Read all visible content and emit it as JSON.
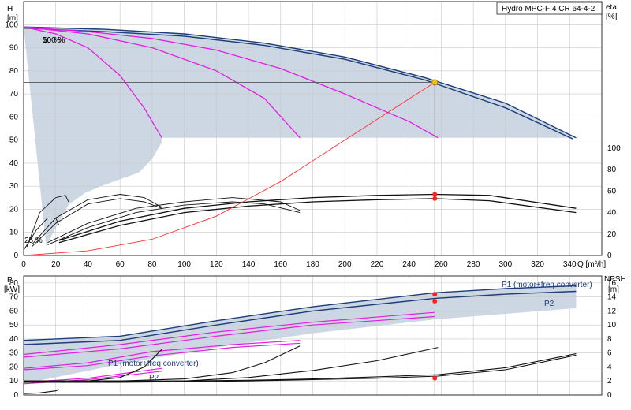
{
  "title": "Hydro MPC-F 4 CR 64-4-2",
  "chart_data": [
    {
      "type": "line",
      "name": "head_efficiency",
      "title": "Hydro MPC-F 4 CR 64-4-2",
      "xlabel": "Q [m³/h]",
      "ylabel_left_lines": [
        "H",
        "[m]"
      ],
      "ylabel_right_lines": [
        "eta",
        "[%]"
      ],
      "xlim": [
        0,
        360
      ],
      "ylim_left": [
        0,
        110
      ],
      "ylim_right_eta": [
        0,
        100
      ],
      "x_ticks": [
        0,
        20,
        40,
        60,
        80,
        100,
        120,
        140,
        160,
        180,
        200,
        220,
        240,
        260,
        280,
        300,
        320,
        340
      ],
      "y_ticks_left": [
        0,
        10,
        20,
        30,
        40,
        50,
        60,
        70,
        80,
        90,
        100
      ],
      "y_ticks_right": [
        0,
        20,
        40,
        60,
        80,
        100
      ],
      "grid": true,
      "speed_labels": [
        {
          "text": "100 %",
          "q": 23,
          "h": 100
        },
        {
          "text": "50 %",
          "q": 23,
          "h": 100
        },
        {
          "text": "25 %",
          "q": 0,
          "h": 7
        }
      ],
      "duty_point": {
        "q": 256,
        "h": 75
      },
      "head_curves_blue": [
        {
          "q": [
            0,
            50,
            100,
            150,
            200,
            250,
            300,
            344
          ],
          "h": [
            99,
            98,
            96,
            92,
            86,
            77,
            66,
            51
          ]
        },
        {
          "q": [
            0,
            50,
            100,
            150,
            200,
            250,
            300,
            342
          ],
          "h": [
            98.5,
            97,
            95,
            91,
            85,
            76,
            64,
            50.5
          ]
        }
      ],
      "head_curves_magenta": [
        {
          "q": [
            0,
            40,
            80,
            120,
            160,
            200,
            240,
            258
          ],
          "h": [
            99,
            97,
            94,
            89,
            81,
            70,
            58,
            51
          ]
        },
        {
          "q": [
            0,
            40,
            80,
            120,
            150,
            172
          ],
          "h": [
            99,
            96,
            90,
            80,
            68,
            51
          ]
        },
        {
          "q": [
            0,
            20,
            40,
            60,
            75,
            86
          ],
          "h": [
            99,
            96,
            90,
            78,
            64,
            51
          ]
        }
      ],
      "eff_curves_black": [
        {
          "q": [
            22,
            60,
            100,
            140,
            180,
            220,
            256,
            290,
            344
          ],
          "e": [
            14,
            32,
            44,
            50,
            54,
            56,
            57,
            56,
            44
          ]
        },
        {
          "q": [
            22,
            60,
            100,
            140,
            180,
            220,
            256,
            290,
            344
          ],
          "e": [
            12,
            28,
            40,
            46,
            50,
            52,
            53,
            51,
            40
          ]
        },
        {
          "q": [
            15,
            40,
            70,
            100,
            130,
            160,
            172
          ],
          "e": [
            12,
            30,
            44,
            50,
            54,
            50,
            42
          ]
        },
        {
          "q": [
            15,
            40,
            70,
            100,
            130,
            150,
            172
          ],
          "e": [
            10,
            26,
            40,
            47,
            50,
            48,
            40
          ]
        },
        {
          "q": [
            5,
            20,
            40,
            60,
            75,
            86
          ],
          "e": [
            10,
            35,
            52,
            57,
            54,
            45
          ]
        },
        {
          "q": [
            5,
            20,
            40,
            60,
            75,
            86
          ],
          "e": [
            8,
            30,
            48,
            53,
            50,
            44
          ]
        },
        {
          "q": [
            0,
            8,
            15,
            20,
            22
          ],
          "e": [
            5,
            24,
            35,
            35,
            28
          ]
        },
        {
          "q": [
            2,
            10,
            20,
            26,
            28
          ],
          "e": [
            8,
            40,
            54,
            56,
            50
          ]
        }
      ],
      "system_curve_red": {
        "q": [
          0,
          40,
          80,
          120,
          160,
          200,
          256
        ],
        "h": [
          0,
          2,
          7,
          17,
          32,
          50,
          75
        ]
      }
    },
    {
      "type": "line",
      "name": "power_npsh",
      "ylabel_left_lines": [
        "P",
        "[kW]"
      ],
      "ylabel_right_lines": [
        "NPSH",
        "[m]"
      ],
      "xlim": [
        0,
        360
      ],
      "ylim_left": [
        0,
        85
      ],
      "ylim_right": [
        0,
        17
      ],
      "y_ticks_left": [
        0,
        10,
        20,
        30,
        40,
        50,
        60,
        70,
        80
      ],
      "y_ticks_right": [
        0,
        2,
        4,
        6,
        8,
        10,
        12,
        14,
        16
      ],
      "grid": true,
      "annotations": [
        {
          "text": "P1 (motor+freq.converter)",
          "q": 332,
          "p": 78
        },
        {
          "text": "P2",
          "q": 350,
          "p": 67
        },
        {
          "text": "P1 (motor+freq.converter)",
          "q": 130,
          "p": 24
        },
        {
          "text": "P2",
          "q": 133,
          "p": 8
        }
      ],
      "duty_points": [
        {
          "q": 256,
          "p": 72
        },
        {
          "q": 256,
          "p": 67
        },
        {
          "q": 256,
          "npsh": 2.4
        }
      ],
      "power_curves_blue": [
        {
          "q": [
            0,
            60,
            120,
            180,
            256,
            300,
            344
          ],
          "p": [
            39,
            42,
            53,
            63,
            73,
            76,
            78
          ]
        },
        {
          "q": [
            0,
            60,
            120,
            180,
            256,
            300,
            344
          ],
          "p": [
            36,
            39,
            50,
            60,
            69,
            72,
            74
          ]
        }
      ],
      "power_curves_magenta": [
        {
          "q": [
            0,
            60,
            120,
            180,
            256
          ],
          "p": [
            29,
            36,
            45,
            52,
            59
          ]
        },
        {
          "q": [
            0,
            60,
            120,
            180,
            256
          ],
          "p": [
            27,
            33,
            42,
            50,
            56
          ]
        },
        {
          "q": [
            0,
            40,
            80,
            130,
            172
          ],
          "p": [
            19,
            23,
            31,
            36,
            39
          ]
        },
        {
          "q": [
            0,
            40,
            80,
            130,
            172
          ],
          "p": [
            18,
            21,
            28,
            34,
            37
          ]
        },
        {
          "q": [
            0,
            40,
            86
          ],
          "p": [
            9,
            12,
            19
          ]
        },
        {
          "q": [
            0,
            40,
            86
          ],
          "p": [
            8,
            11,
            17
          ]
        }
      ],
      "npsh_curves_black": [
        {
          "q": [
            0,
            60,
            100,
            140,
            180,
            220,
            258,
            300,
            344
          ],
          "npsh": [
            1.8,
            1.8,
            1.9,
            2.0,
            2.2,
            2.4,
            2.7,
            3.6,
            5.7
          ]
        },
        {
          "q": [
            0,
            60,
            100,
            140,
            180,
            220,
            258,
            300,
            344
          ],
          "npsh": [
            1.9,
            1.9,
            2.0,
            2.1,
            2.3,
            2.6,
            2.9,
            3.9,
            5.9
          ]
        },
        {
          "q": [
            0,
            60,
            100,
            130,
            150,
            172
          ],
          "npsh": [
            2.0,
            2.0,
            2.3,
            3.2,
            4.6,
            7.0
          ]
        },
        {
          "q": [
            0,
            100,
            140,
            180,
            220,
            258
          ],
          "npsh": [
            2.0,
            2.0,
            2.5,
            3.5,
            4.9,
            6.8
          ]
        },
        {
          "q": [
            0,
            40,
            60,
            75,
            86
          ],
          "npsh": [
            1.9,
            2.0,
            2.5,
            4.0,
            6.5
          ]
        },
        {
          "q": [
            0,
            10,
            20,
            22
          ],
          "npsh": [
            0.2,
            0.3,
            0.6,
            0.8
          ]
        }
      ]
    }
  ]
}
